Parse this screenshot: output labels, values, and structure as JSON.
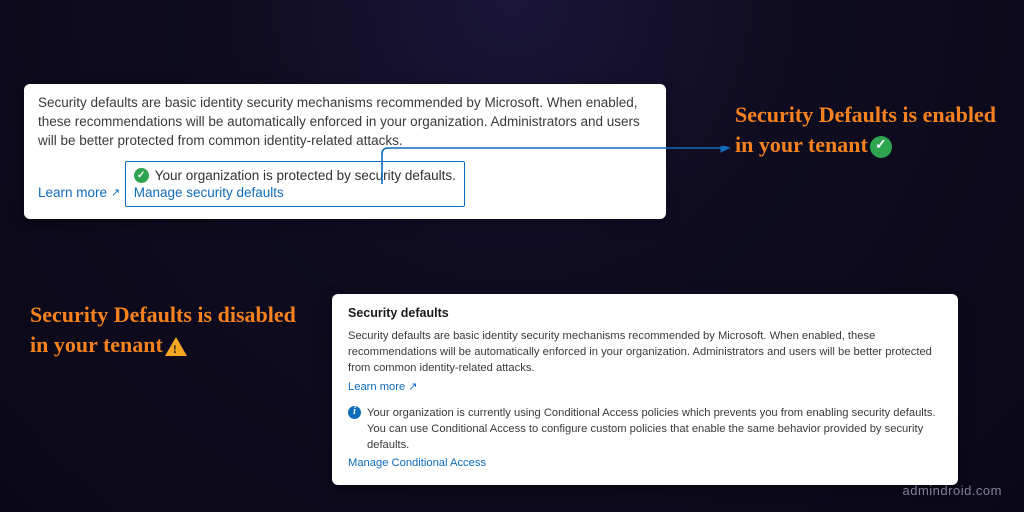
{
  "panelTop": {
    "description": "Security defaults are basic identity security mechanisms recommended by Microsoft. When enabled, these recommendations will be automatically enforced in your organization. Administrators and users will be better protected from common identity-related attacks.",
    "learnMore": "Learn more",
    "statusText": "Your organization is protected by security defaults.",
    "manageLink": "Manage security defaults"
  },
  "panelBottom": {
    "heading": "Security defaults",
    "description": "Security defaults are basic identity security mechanisms recommended by Microsoft. When enabled, these recommendations will be automatically enforced in your organization. Administrators and users will be better protected from common identity-related attacks.",
    "learnMore": "Learn more",
    "infoText": "Your organization is currently using Conditional Access policies which prevents you from enabling security defaults. You can use Conditional Access to configure custom policies that enable the same behavior provided by security defaults.",
    "manageLink": "Manage Conditional Access"
  },
  "callouts": {
    "enabled": "Security Defaults is enabled in your tenant",
    "disabled": "Security Defaults is disabled in your tenant"
  },
  "watermark": "admindroid.com"
}
